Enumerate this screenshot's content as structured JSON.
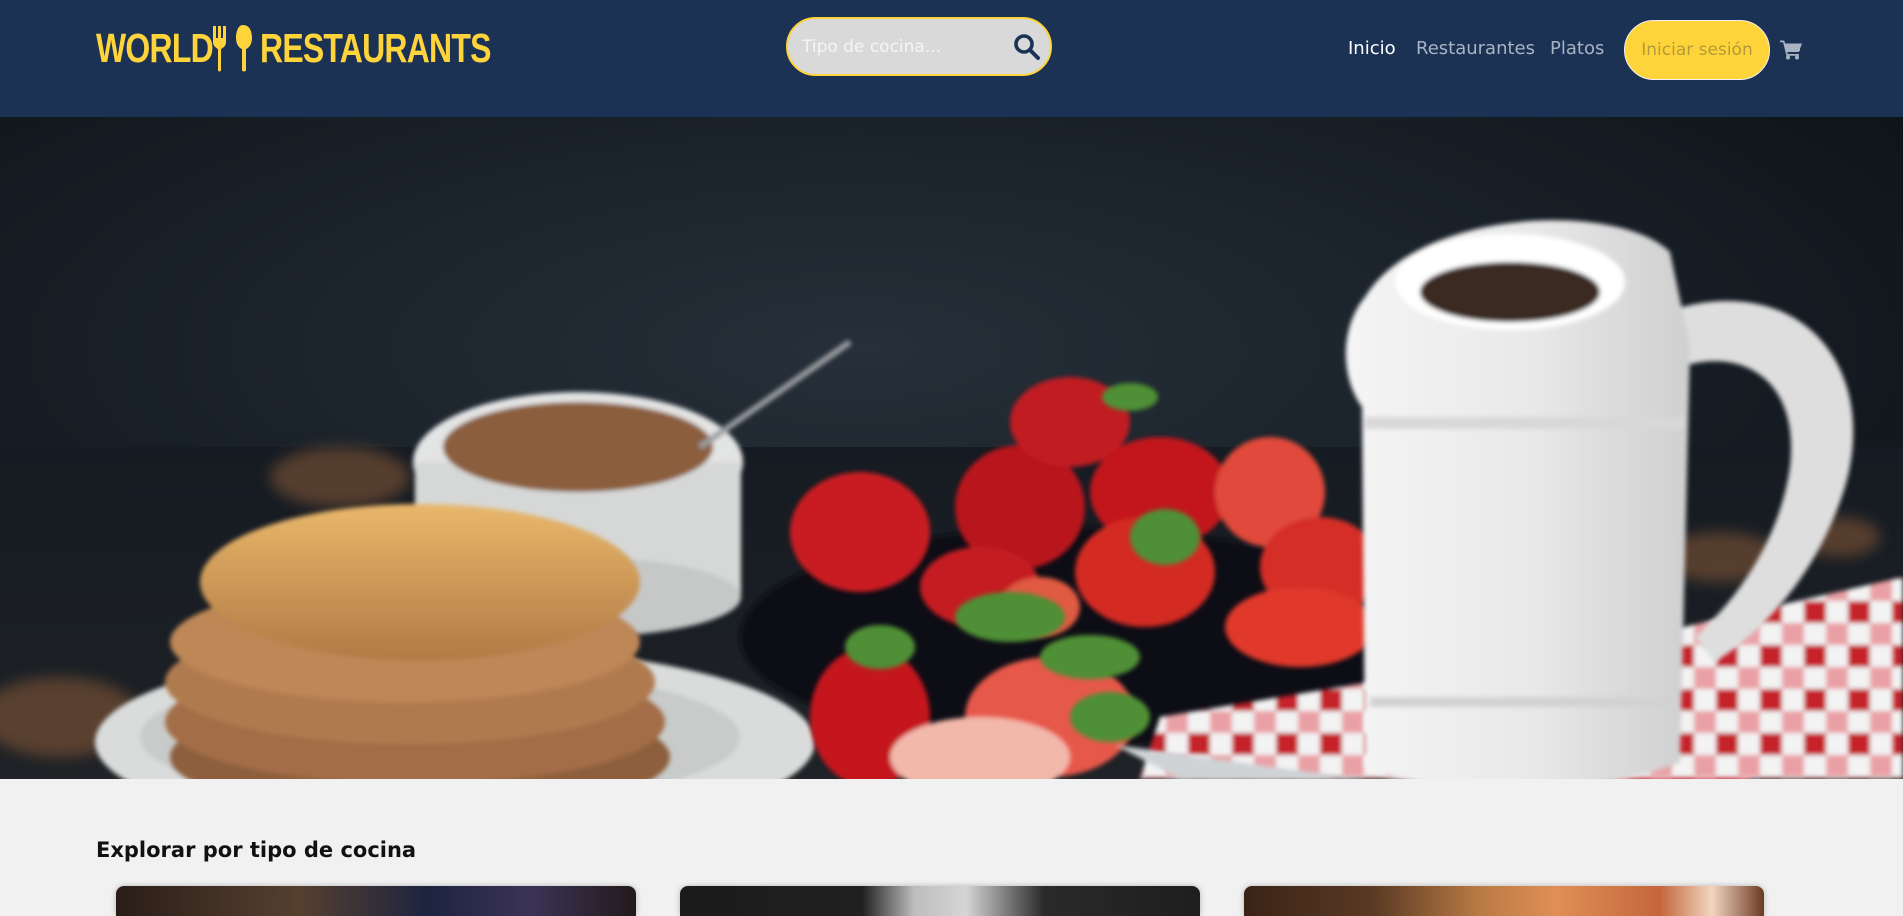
{
  "brand": {
    "word_left": "WORLD",
    "word_right": "RESTAURANTS",
    "color": "#ffd43b",
    "icon": "fork-spoon-icon"
  },
  "search": {
    "placeholder": "Tipo de cocina...",
    "value": "",
    "icon": "search-icon"
  },
  "nav": {
    "items": [
      {
        "label": "Inicio",
        "active": true
      },
      {
        "label": "Restaurantes",
        "active": false
      },
      {
        "label": "Platos",
        "active": false
      }
    ],
    "login_label": "Iniciar sesión",
    "cart_icon": "shopping-cart-icon"
  },
  "hero": {
    "image": "pancakes-strawberries-pitcher-photo"
  },
  "explore": {
    "title": "Explorar por tipo de cocina",
    "cards": [
      {
        "image": "cuisine-card-image-1"
      },
      {
        "image": "cuisine-card-image-2"
      },
      {
        "image": "cuisine-card-image-3"
      }
    ]
  },
  "colors": {
    "navbar": "#1b3254",
    "accent": "#ffd43b",
    "page_background": "#f1f1f1"
  }
}
